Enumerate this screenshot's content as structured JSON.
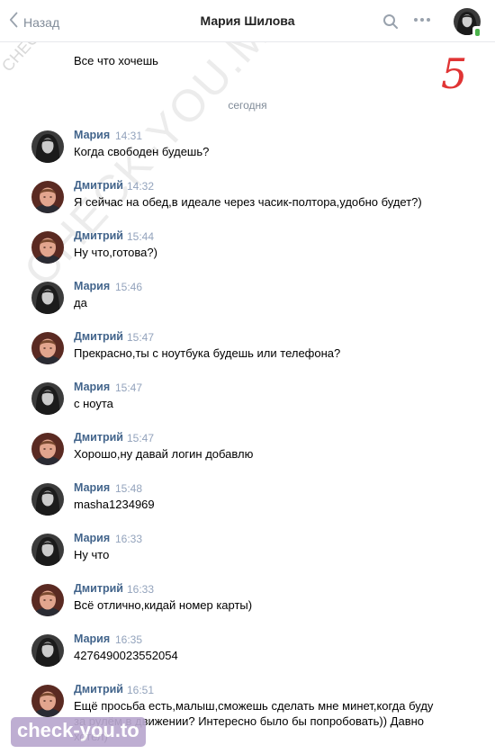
{
  "header": {
    "back_label": "Назад",
    "title": "Мария Шилова"
  },
  "intro_message": "Все что хочешь",
  "day_separator": "сегодня",
  "messages": [
    {
      "author": "Мария",
      "time": "14:31",
      "text": "Когда свободен будешь?"
    },
    {
      "author": "Дмитрий",
      "time": "14:32",
      "text": "Я сейчас на обед,в идеале через часик-полтора,удобно будет?)"
    },
    {
      "author": "Дмитрий",
      "time": "15:44",
      "text": "Ну что,готова?)"
    },
    {
      "author": "Мария",
      "time": "15:46",
      "text": "да"
    },
    {
      "author": "Дмитрий",
      "time": "15:47",
      "text": "Прекрасно,ты с ноутбука будешь или телефона?"
    },
    {
      "author": "Мария",
      "time": "15:47",
      "text": "с ноута"
    },
    {
      "author": "Дмитрий",
      "time": "15:47",
      "text": "Хорошо,ну давай логин добавлю"
    },
    {
      "author": "Мария",
      "time": "15:48",
      "text": "masha1234969"
    },
    {
      "author": "Мария",
      "time": "16:33",
      "text": "Ну что"
    },
    {
      "author": "Дмитрий",
      "time": "16:33",
      "text": "Всё отлично,кидай номер карты)"
    },
    {
      "author": "Мария",
      "time": "16:35",
      "text": "4276490023552054"
    },
    {
      "author": "Дмитрий",
      "time": "16:51",
      "text": "Ещё просьба есть,малыш,сможешь сделать мне минет,когда буду за рулём в движении? Интересно было бы попробовать)) Давно хотел)"
    }
  ],
  "overlays": {
    "watermark_small": "CHECK-YOU.ME",
    "watermark_large": "CHECK-YOU.ME",
    "page_number": "5",
    "bottom_watermark": "check-you.to"
  },
  "colors": {
    "author": "#42648b",
    "time": "#93a3bc",
    "online": "#4bb34b",
    "page_number": "#e03434"
  }
}
